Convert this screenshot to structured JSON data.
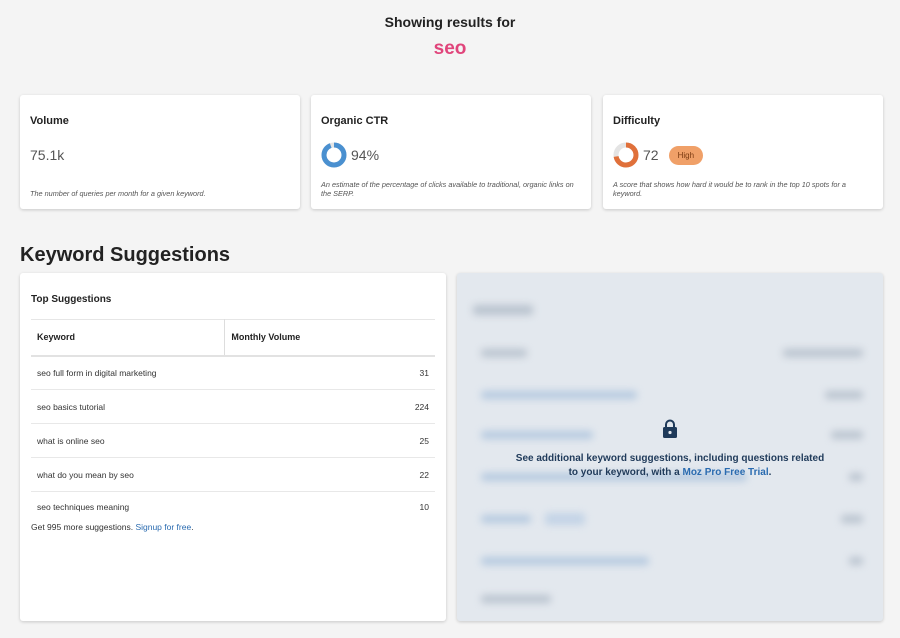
{
  "header": {
    "showing_label": "Showing results for",
    "keyword": "seo"
  },
  "metrics": {
    "volume": {
      "title": "Volume",
      "value": "75.1k",
      "desc": "The number of queries per month for a given keyword."
    },
    "ctr": {
      "title": "Organic CTR",
      "value": "94%",
      "percent": 94,
      "color": "#4a90d0",
      "desc": "An estimate of the percentage of clicks available to traditional, organic links on the SERP."
    },
    "difficulty": {
      "title": "Difficulty",
      "value": "72",
      "percent": 72,
      "color": "#e0703a",
      "badge": "High",
      "desc": "A score that shows how hard it would be to rank in the top 10 spots for a keyword."
    }
  },
  "section_title": "Keyword Suggestions",
  "top_suggestions": {
    "title": "Top Suggestions",
    "columns": [
      "Keyword",
      "Monthly Volume"
    ],
    "rows": [
      {
        "keyword": "seo full form in digital marketing",
        "volume": "31"
      },
      {
        "keyword": "seo basics tutorial",
        "volume": "224"
      },
      {
        "keyword": "what is online seo",
        "volume": "25"
      },
      {
        "keyword": "what do you mean by seo",
        "volume": "22"
      },
      {
        "keyword": "seo techniques meaning",
        "volume": "10"
      }
    ],
    "more_text": "Get 995 more suggestions.",
    "signup_link": "Signup for free",
    "period": "."
  },
  "locked_panel": {
    "icon": "lock-icon",
    "msg_line1": "See additional keyword suggestions, including questions related",
    "msg_line2_prefix": "to your keyword, with a ",
    "msg_link": "Moz Pro Free Trial",
    "msg_suffix": "."
  }
}
